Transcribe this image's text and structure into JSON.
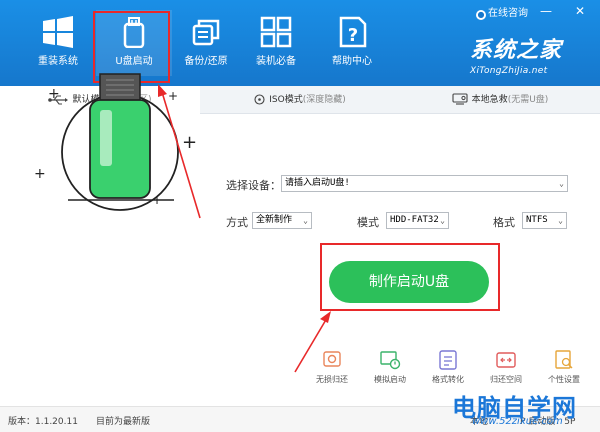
{
  "header": {
    "nav": [
      {
        "label": "重装系统"
      },
      {
        "label": "U盘启动"
      },
      {
        "label": "备份/还原"
      },
      {
        "label": "装机必备"
      },
      {
        "label": "帮助中心"
      }
    ],
    "online_label": "在线咨询",
    "minimize": "—",
    "close": "✕",
    "brand_cn": "系统之家",
    "brand_en": "XiTongZhiJia.net"
  },
  "tabs": [
    {
      "label": "默认模式",
      "sub": "(隐藏分区)"
    },
    {
      "label": "ISO模式",
      "sub": "(深度隐藏)"
    },
    {
      "label": "本地急救",
      "sub": "(无需U盘)"
    }
  ],
  "form": {
    "device_label": "选择设备：",
    "device_value": "请插入启动U盘!",
    "method_label": "方式",
    "method_value": "全新制作",
    "mode_label": "模式",
    "mode_value": "HDD-FAT32",
    "format_label": "格式",
    "format_value": "NTFS",
    "make_button": "制作启动U盘"
  },
  "tools": [
    {
      "label": "无损归还"
    },
    {
      "label": "模拟启动"
    },
    {
      "label": "格式转化"
    },
    {
      "label": "归还空间"
    },
    {
      "label": "个性设置"
    }
  ],
  "status": {
    "version": "版本：1.1.20.11",
    "latest": "目前为最新版",
    "right": "本地：",
    "right2": "P    启动版：5P"
  },
  "watermark": {
    "cn": "电脑自学网",
    "url": "www.52zixue.com"
  },
  "colors": {
    "header_blue": "#1677cc",
    "button_green": "#2cc05a",
    "highlight_red": "#e8292a"
  }
}
